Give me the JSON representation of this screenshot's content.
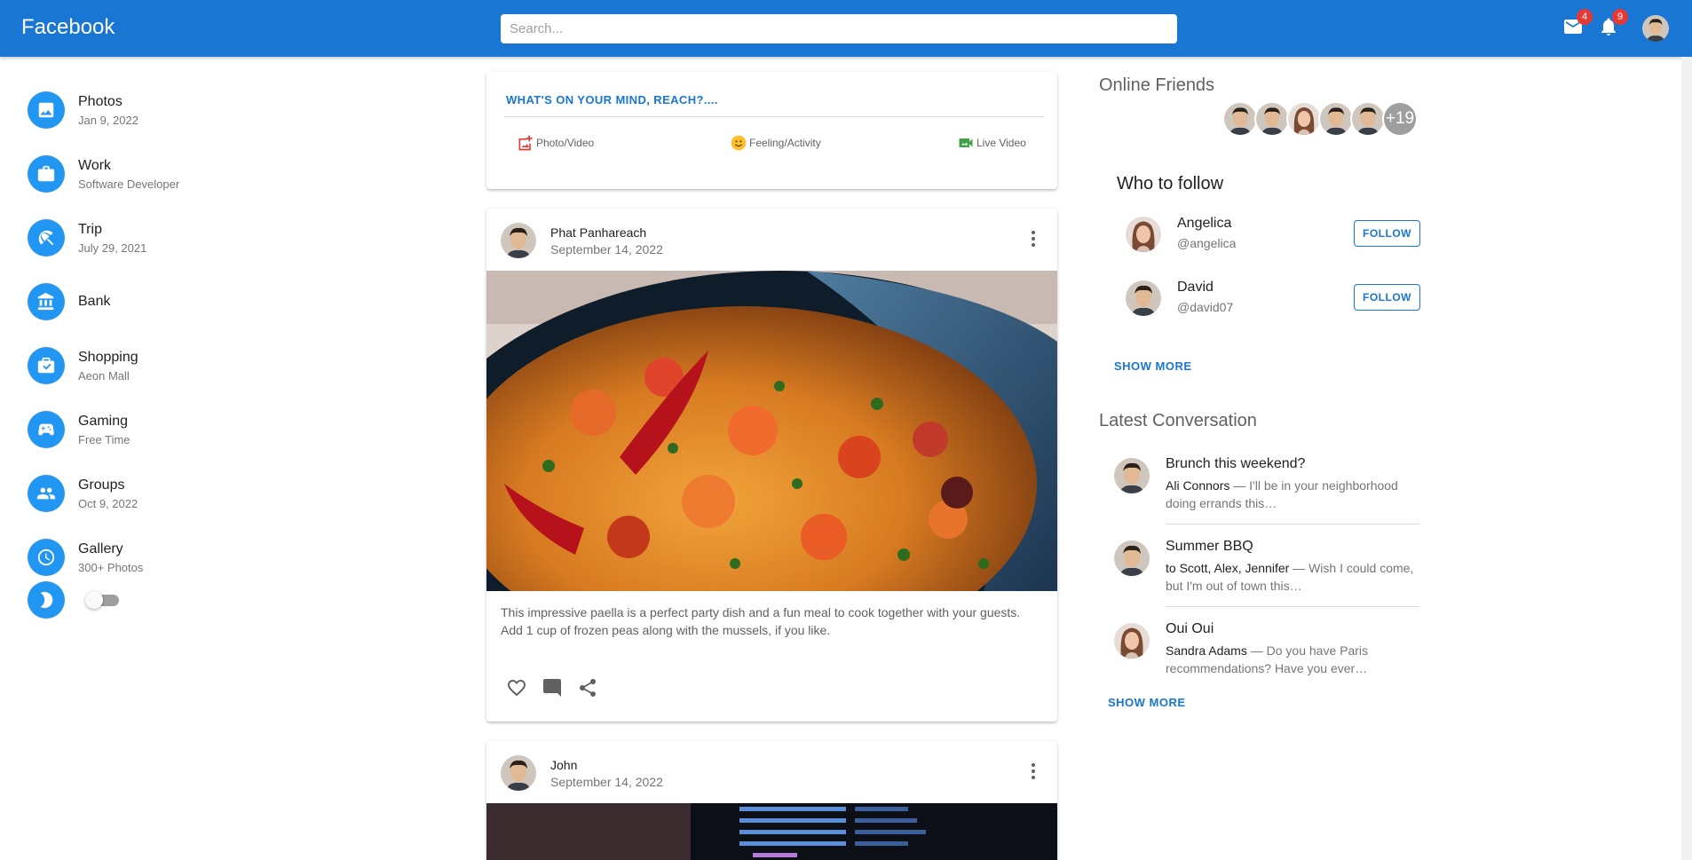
{
  "header": {
    "brand": "Facebook",
    "search_placeholder": "Search...",
    "mail_count": "4",
    "notification_count": "9"
  },
  "sidebar": {
    "items": [
      {
        "title": "Photos",
        "subtitle": "Jan 9, 2022",
        "icon": "image-icon"
      },
      {
        "title": "Work",
        "subtitle": "Software Developer",
        "icon": "briefcase-icon"
      },
      {
        "title": "Trip",
        "subtitle": "July 29, 2021",
        "icon": "beach-icon"
      },
      {
        "title": "Bank",
        "subtitle": "",
        "icon": "bank-icon"
      },
      {
        "title": "Shopping",
        "subtitle": "Aeon Mall",
        "icon": "shopping-icon"
      },
      {
        "title": "Gaming",
        "subtitle": "Free Time",
        "icon": "gamepad-icon"
      },
      {
        "title": "Groups",
        "subtitle": "Oct 9, 2022",
        "icon": "groups-icon"
      },
      {
        "title": "Gallery",
        "subtitle": "300+ Photos",
        "icon": "gallery-icon"
      }
    ],
    "dark_mode_icon": "moon-icon",
    "dark_mode_on": false
  },
  "composer": {
    "prompt": "WHAT'S ON YOUR MIND, REACH?....",
    "photo_video": "Photo/Video",
    "feeling_activity": "Feeling/Activity",
    "live_video": "Live Video"
  },
  "posts": [
    {
      "author": "Phat Panhareach",
      "date": "September 14, 2022",
      "text": "This impressive paella is a perfect party dish and a fun meal to cook together with your guests. Add 1 cup of frozen peas along with the mussels, if you like."
    },
    {
      "author": "John",
      "date": "September 14, 2022"
    }
  ],
  "online_friends": {
    "title": "Online Friends",
    "more_count": "+19"
  },
  "who_to_follow": {
    "title": "Who to follow",
    "users": [
      {
        "name": "Angelica",
        "handle": "@angelica",
        "button": "FOLLOW"
      },
      {
        "name": "David",
        "handle": "@david07",
        "button": "FOLLOW"
      }
    ],
    "show_more": "SHOW MORE"
  },
  "latest_conversation": {
    "title": "Latest Conversation",
    "items": [
      {
        "title": "Brunch this weekend?",
        "from": "Ali Connors",
        "snippet": " — I'll be in your neighborhood doing errands this…"
      },
      {
        "title": "Summer BBQ",
        "from": "to Scott, Alex, Jennifer",
        "snippet": " — Wish I could come, but I'm out of town this…"
      },
      {
        "title": "Oui Oui",
        "from": "Sandra Adams",
        "snippet": " — Do you have Paris recommendations? Have you ever…"
      }
    ],
    "show_more": "SHOW MORE"
  },
  "colors": {
    "primary": "#1976d2",
    "icon_circle": "#2196f3",
    "badge": "#e53935"
  }
}
